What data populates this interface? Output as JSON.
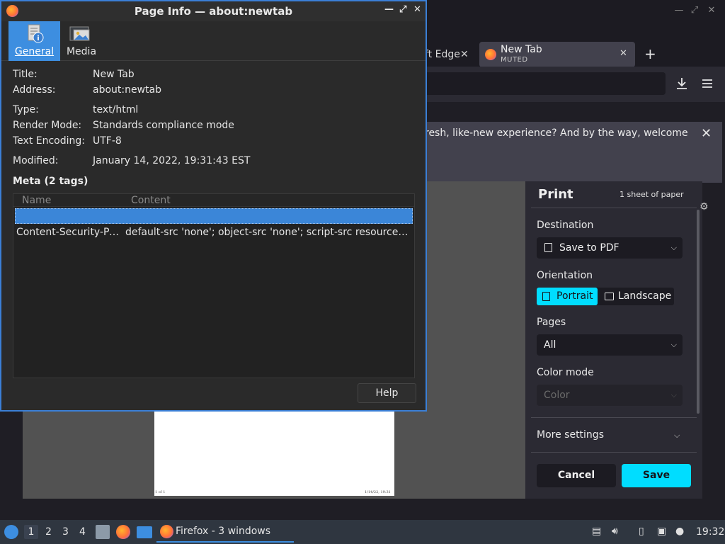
{
  "browser": {
    "tabs": [
      {
        "label": "ft Edge"
      },
      {
        "label": "New Tab",
        "sublabel": "MUTED"
      }
    ],
    "notification": "resh, like-new experience? And by the way, welcome",
    "preview": {
      "left_footer": "1 of 1",
      "right_footer": "1/14/22, 19:31"
    }
  },
  "print": {
    "title": "Print",
    "sheets": "1 sheet of paper",
    "destination_label": "Destination",
    "destination_value": "Save to PDF",
    "orientation_label": "Orientation",
    "portrait": "Portrait",
    "landscape": "Landscape",
    "pages_label": "Pages",
    "pages_value": "All",
    "color_label": "Color mode",
    "color_value": "Color",
    "more_settings": "More settings",
    "cancel": "Cancel",
    "save": "Save"
  },
  "dialog": {
    "title": "Page Info — about:newtab",
    "tabs": [
      {
        "label": "General"
      },
      {
        "label": "Media"
      }
    ],
    "fields": {
      "title_label": "Title:",
      "title_value": "New Tab",
      "address_label": "Address:",
      "address_value": "about:newtab",
      "type_label": "Type:",
      "type_value": "text/html",
      "render_label": "Render Mode:",
      "render_value": "Standards compliance mode",
      "encoding_label": "Text Encoding:",
      "encoding_value": "UTF-8",
      "modified_label": "Modified:",
      "modified_value": "January 14, 2022, 19:31:43 EST"
    },
    "meta_heading": "Meta (2 tags)",
    "meta_columns": {
      "name": "Name",
      "content": "Content"
    },
    "meta_rows": [
      {
        "name": "Content-Security-Pol...",
        "content": "default-src 'none'; object-src 'none'; script-src resource: c..."
      }
    ],
    "help": "Help"
  },
  "taskbar": {
    "workspaces": [
      "1",
      "2",
      "3",
      "4"
    ],
    "task_label": "Firefox - 3 windows",
    "clock": "19:32"
  },
  "colors": {
    "accent": "#00ddff",
    "selection": "#3b86d8",
    "dialog_border": "#3b7fd6"
  }
}
